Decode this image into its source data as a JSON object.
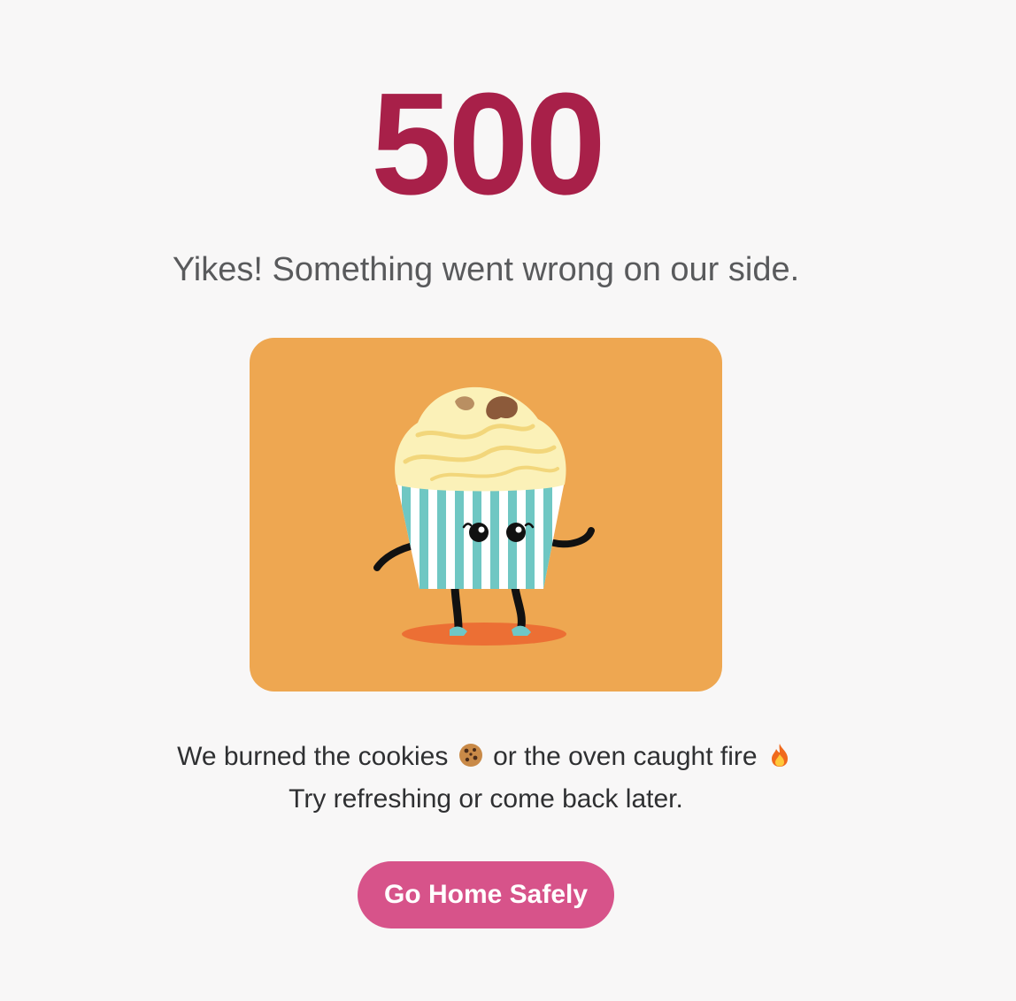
{
  "error": {
    "code": "500",
    "subtitle": "Yikes! Something went wrong on our side."
  },
  "illustration": {
    "subject": "cupcake-icon"
  },
  "message": {
    "line1_before": "We burned the cookies",
    "line1_middle": "or the oven caught fire",
    "line2": "Try refreshing or come back later.",
    "emoji_1": "cookie-icon",
    "emoji_2": "fire-icon"
  },
  "actions": {
    "home_label": "Go Home Safely"
  },
  "colors": {
    "background": "#f8f7f7",
    "error_code": "#a82049",
    "subtitle": "#595a5c",
    "illustration_bg": "#eea751",
    "button_bg": "#d7538a",
    "button_text": "#ffffff"
  }
}
